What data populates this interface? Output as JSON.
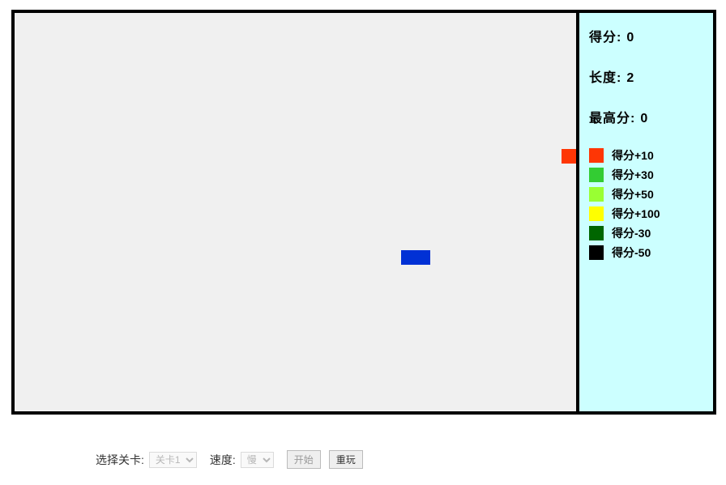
{
  "stats": {
    "score_label": "得分",
    "score_value": "0",
    "length_label": "长度",
    "length_value": "2",
    "hiscore_label": "最高分",
    "hiscore_value": "0"
  },
  "legend": [
    {
      "color": "#fe3605",
      "label": "得分+10"
    },
    {
      "color": "#33cc33",
      "label": "得分+30"
    },
    {
      "color": "#99ff33",
      "label": "得分+50"
    },
    {
      "color": "#ffff00",
      "label": "得分+100"
    },
    {
      "color": "#006600",
      "label": "得分-30"
    },
    {
      "color": "#000000",
      "label": "得分-50"
    }
  ],
  "controls": {
    "level_label": "选择关卡:",
    "level_options": [
      "关卡1"
    ],
    "level_selected": "关卡1",
    "speed_label": "速度:",
    "speed_options": [
      "慢"
    ],
    "speed_selected": "慢",
    "start_label": "开始",
    "replay_label": "重玩"
  },
  "game": {
    "food_color": "#fe3605",
    "snake_color": "#0131d5"
  }
}
